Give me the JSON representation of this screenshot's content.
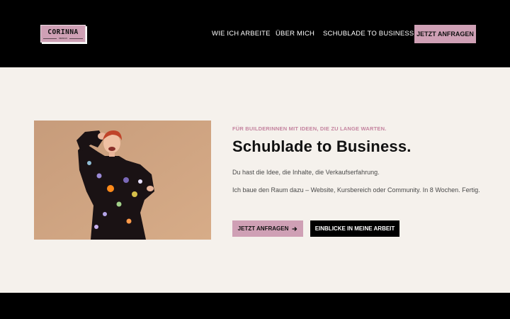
{
  "header": {
    "logo_text": "CORINNA",
    "logo_subtext": "DESIGN",
    "nav": [
      "WIE ICH ARBEITE",
      "ÜBER MICH",
      "SCHUBLADE TO BUSINESS"
    ],
    "cta_label": "JETZT ANFRAGEN"
  },
  "hero": {
    "eyebrow": "FÜR BUILDERINNEN MIT IDEEN, DIE ZU LANGE WARTEN.",
    "title": "Schublade to Business.",
    "paragraph_1": "Du hast die Idee, die Inhalte, die Verkaufserfahrung.",
    "paragraph_2": "Ich baue den Raum dazu – Website, Kursbereich oder Community. In 8 Wochen. Fertig.",
    "primary_button": "JETZT ANFRAGEN",
    "primary_button_icon": "arrow-right-icon",
    "secondary_button": "EINBLICKE IN MEINE ARBEIT"
  },
  "colors": {
    "accent": "#cfa0b5",
    "eyebrow": "#c4849f",
    "background": "#f5f1ec",
    "dark": "#000000"
  }
}
